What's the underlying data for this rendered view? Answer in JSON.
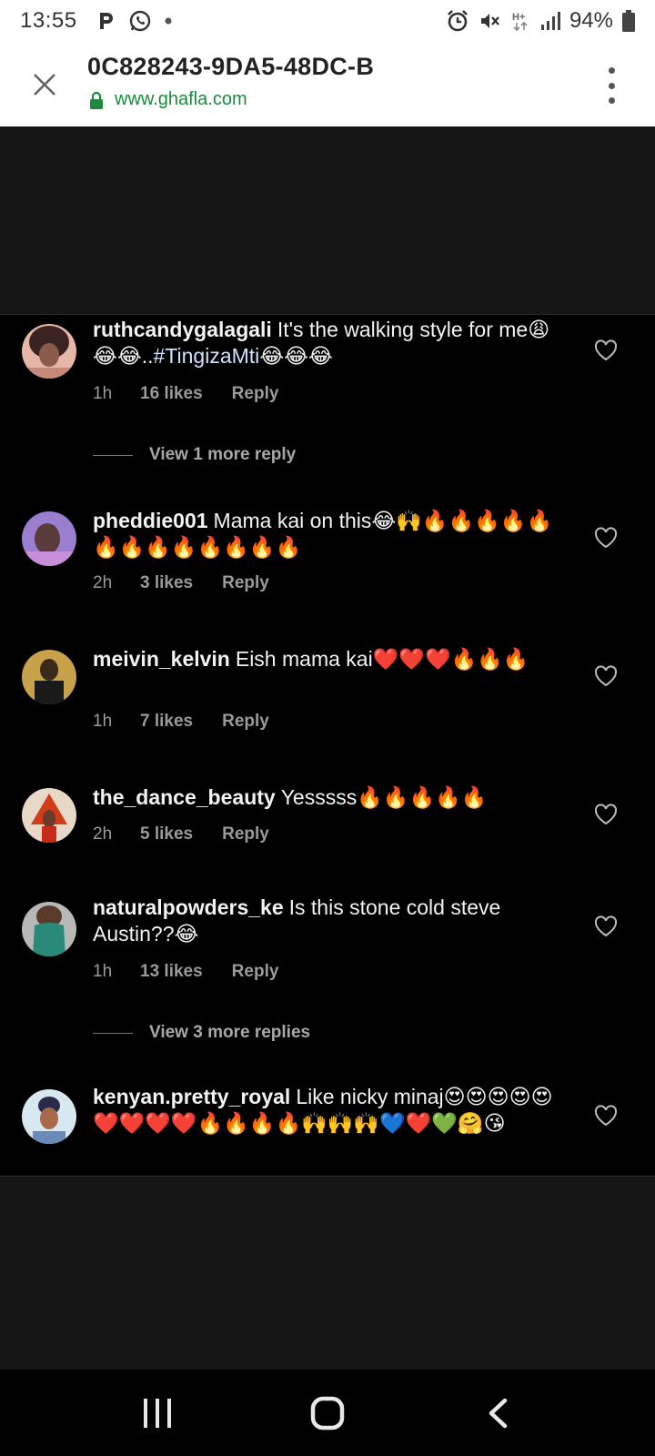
{
  "status_bar": {
    "time": "13:55",
    "battery": "94%",
    "icons_left": [
      "parking-icon",
      "whatsapp-icon",
      "dot-icon"
    ],
    "icons_right": [
      "alarm-icon",
      "vibrate-mute-icon",
      "hplus-data-icon",
      "signal-icon",
      "battery-icon"
    ]
  },
  "browser": {
    "title": "0C828243-9DA5-48DC-B",
    "url": "www.ghafla.com",
    "url_color": "#1a8a3c",
    "lock_color": "#1a8a3c"
  },
  "comments": [
    {
      "username": "ruthcandygalagali",
      "text": "It's the walking style for me😩😂😂..",
      "hashtag": "#TingizaMti",
      "after": "😂😂😂",
      "time": "1h",
      "likes": "16 likes",
      "reply": "Reply",
      "view_more": "View 1 more reply"
    },
    {
      "username": "pheddie001",
      "text": "Mama kai on this😂🙌🔥🔥🔥🔥🔥🔥🔥🔥🔥🔥🔥🔥🔥",
      "time": "2h",
      "likes": "3 likes",
      "reply": "Reply"
    },
    {
      "username": "meivin_kelvin",
      "text": "Eish mama kai❤️❤️❤️🔥🔥🔥",
      "time": "1h",
      "likes": "7 likes",
      "reply": "Reply"
    },
    {
      "username": "the_dance_beauty",
      "text": "Yesssss🔥🔥🔥🔥🔥",
      "time": "2h",
      "likes": "5 likes",
      "reply": "Reply"
    },
    {
      "username": "naturalpowders_ke",
      "text": "Is this stone cold steve Austin??😂",
      "time": "1h",
      "likes": "13 likes",
      "reply": "Reply",
      "view_more": "View 3 more replies"
    },
    {
      "username": "kenyan.pretty_royal",
      "text": "Like nicky minaj😍😍😍😍😍❤️❤️❤️❤️🔥🔥🔥🔥🙌🙌🙌💙❤️💚🤗😘"
    }
  ],
  "nav": [
    "recent-apps-icon",
    "home-icon",
    "back-icon"
  ]
}
